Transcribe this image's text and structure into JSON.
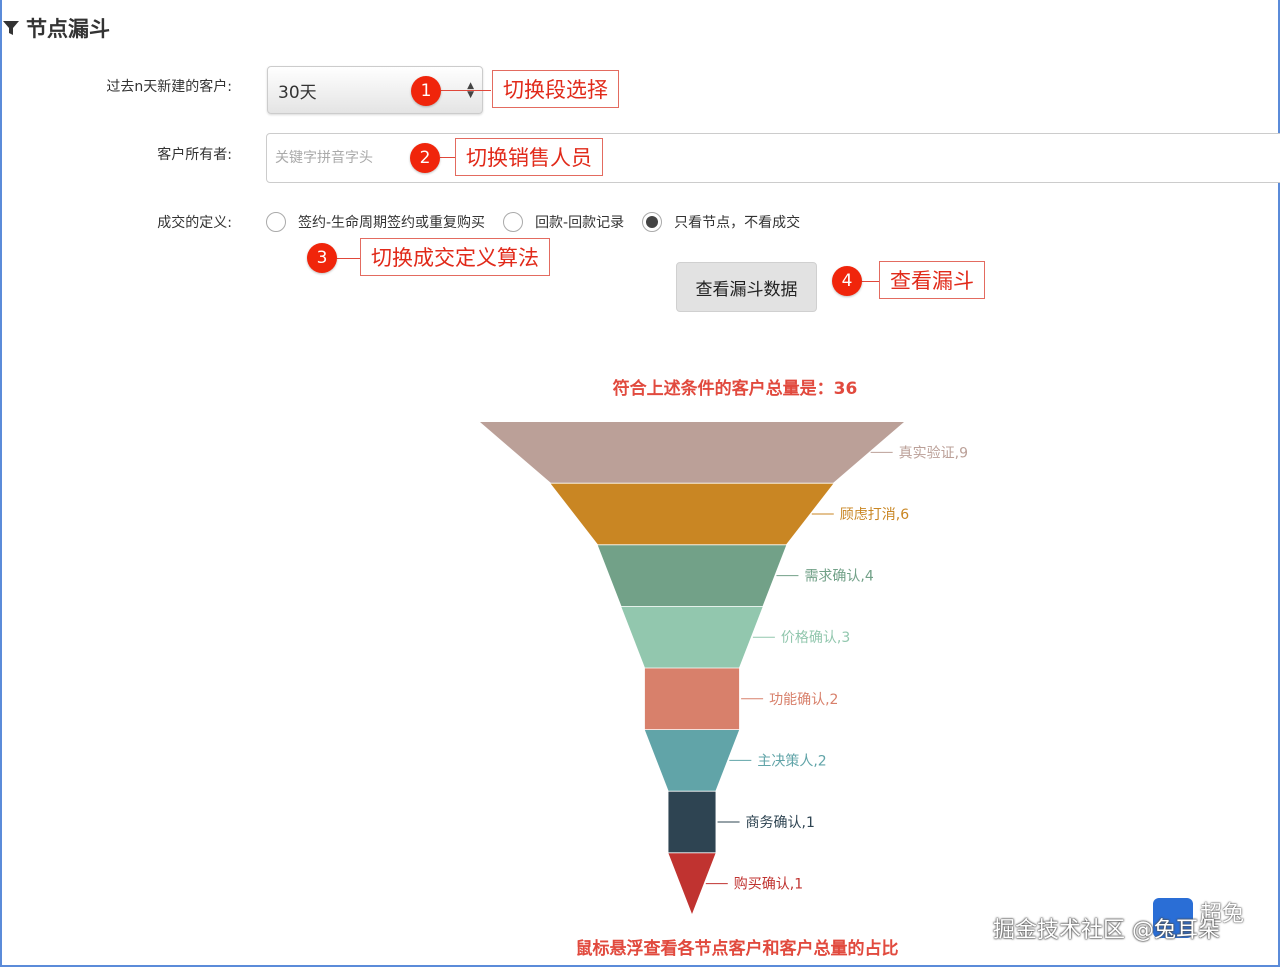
{
  "panel": {
    "title": "节点漏斗"
  },
  "form": {
    "period_label": "过去n天新建的客户:",
    "period_value": "30天",
    "owner_label": "客户所有者:",
    "owner_placeholder": "关键字拼音字头",
    "deal_label": "成交的定义:",
    "deal_options": [
      {
        "label": "签约-生命周期签约或重复购买",
        "checked": false
      },
      {
        "label": "回款-回款记录",
        "checked": false
      },
      {
        "label": "只看节点，不看成交",
        "checked": true
      }
    ],
    "query_button": "查看漏斗数据"
  },
  "annotations": [
    {
      "num": "1",
      "text": "切换段选择"
    },
    {
      "num": "2",
      "text": "切换销售人员"
    },
    {
      "num": "3",
      "text": "切换成交定义算法"
    },
    {
      "num": "4",
      "text": "查看漏斗"
    }
  ],
  "total_text": "符合上述条件的客户总量是：36",
  "hint_text": "鼠标悬浮查看各节点客户和客户总量的占比",
  "watermark": {
    "text": "掘金技术社区 @兔耳朵",
    "logo_text": "超兔"
  },
  "chart_data": {
    "type": "funnel",
    "labels": [
      "真实验证,9",
      "顾虑打消,6",
      "需求确认,4",
      "价格确认,3",
      "功能确认,2",
      "主决策人,2",
      "商务确认,1",
      "购买确认,1"
    ],
    "stages": [
      "真实验证",
      "顾虑打消",
      "需求确认",
      "价格确认",
      "功能确认",
      "主决策人",
      "商务确认",
      "购买确认"
    ],
    "values": [
      9,
      6,
      4,
      3,
      2,
      2,
      1,
      1
    ],
    "colors": [
      "#bba098",
      "#c98623",
      "#72a188",
      "#92c7ae",
      "#d8806b",
      "#61a4a8",
      "#2e4452",
      "#c03330"
    ]
  }
}
